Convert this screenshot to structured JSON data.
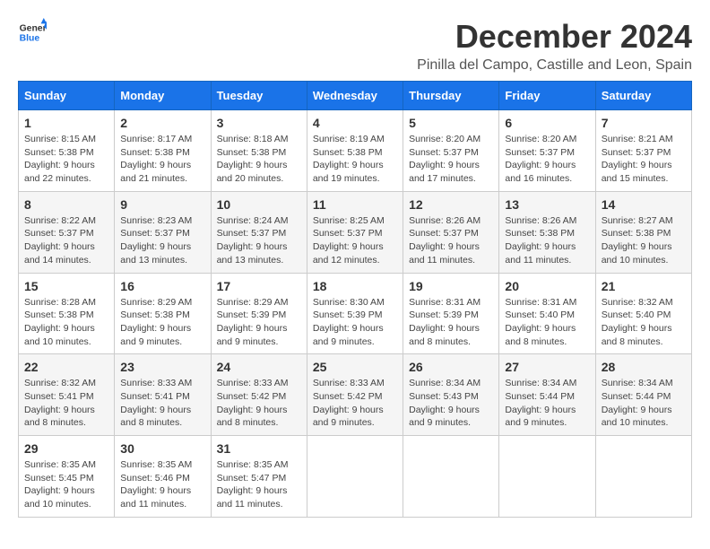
{
  "logo": {
    "line1": "General",
    "line2": "Blue"
  },
  "header": {
    "month_title": "December 2024",
    "location": "Pinilla del Campo, Castille and Leon, Spain"
  },
  "calendar": {
    "days_of_week": [
      "Sunday",
      "Monday",
      "Tuesday",
      "Wednesday",
      "Thursday",
      "Friday",
      "Saturday"
    ],
    "weeks": [
      [
        {
          "day": "1",
          "sunrise": "8:15 AM",
          "sunset": "5:38 PM",
          "daylight": "9 hours and 22 minutes."
        },
        {
          "day": "2",
          "sunrise": "8:17 AM",
          "sunset": "5:38 PM",
          "daylight": "9 hours and 21 minutes."
        },
        {
          "day": "3",
          "sunrise": "8:18 AM",
          "sunset": "5:38 PM",
          "daylight": "9 hours and 20 minutes."
        },
        {
          "day": "4",
          "sunrise": "8:19 AM",
          "sunset": "5:38 PM",
          "daylight": "9 hours and 19 minutes."
        },
        {
          "day": "5",
          "sunrise": "8:20 AM",
          "sunset": "5:37 PM",
          "daylight": "9 hours and 17 minutes."
        },
        {
          "day": "6",
          "sunrise": "8:20 AM",
          "sunset": "5:37 PM",
          "daylight": "9 hours and 16 minutes."
        },
        {
          "day": "7",
          "sunrise": "8:21 AM",
          "sunset": "5:37 PM",
          "daylight": "9 hours and 15 minutes."
        }
      ],
      [
        {
          "day": "8",
          "sunrise": "8:22 AM",
          "sunset": "5:37 PM",
          "daylight": "9 hours and 14 minutes."
        },
        {
          "day": "9",
          "sunrise": "8:23 AM",
          "sunset": "5:37 PM",
          "daylight": "9 hours and 13 minutes."
        },
        {
          "day": "10",
          "sunrise": "8:24 AM",
          "sunset": "5:37 PM",
          "daylight": "9 hours and 13 minutes."
        },
        {
          "day": "11",
          "sunrise": "8:25 AM",
          "sunset": "5:37 PM",
          "daylight": "9 hours and 12 minutes."
        },
        {
          "day": "12",
          "sunrise": "8:26 AM",
          "sunset": "5:37 PM",
          "daylight": "9 hours and 11 minutes."
        },
        {
          "day": "13",
          "sunrise": "8:26 AM",
          "sunset": "5:38 PM",
          "daylight": "9 hours and 11 minutes."
        },
        {
          "day": "14",
          "sunrise": "8:27 AM",
          "sunset": "5:38 PM",
          "daylight": "9 hours and 10 minutes."
        }
      ],
      [
        {
          "day": "15",
          "sunrise": "8:28 AM",
          "sunset": "5:38 PM",
          "daylight": "9 hours and 10 minutes."
        },
        {
          "day": "16",
          "sunrise": "8:29 AM",
          "sunset": "5:38 PM",
          "daylight": "9 hours and 9 minutes."
        },
        {
          "day": "17",
          "sunrise": "8:29 AM",
          "sunset": "5:39 PM",
          "daylight": "9 hours and 9 minutes."
        },
        {
          "day": "18",
          "sunrise": "8:30 AM",
          "sunset": "5:39 PM",
          "daylight": "9 hours and 9 minutes."
        },
        {
          "day": "19",
          "sunrise": "8:31 AM",
          "sunset": "5:39 PM",
          "daylight": "9 hours and 8 minutes."
        },
        {
          "day": "20",
          "sunrise": "8:31 AM",
          "sunset": "5:40 PM",
          "daylight": "9 hours and 8 minutes."
        },
        {
          "day": "21",
          "sunrise": "8:32 AM",
          "sunset": "5:40 PM",
          "daylight": "9 hours and 8 minutes."
        }
      ],
      [
        {
          "day": "22",
          "sunrise": "8:32 AM",
          "sunset": "5:41 PM",
          "daylight": "9 hours and 8 minutes."
        },
        {
          "day": "23",
          "sunrise": "8:33 AM",
          "sunset": "5:41 PM",
          "daylight": "9 hours and 8 minutes."
        },
        {
          "day": "24",
          "sunrise": "8:33 AM",
          "sunset": "5:42 PM",
          "daylight": "9 hours and 8 minutes."
        },
        {
          "day": "25",
          "sunrise": "8:33 AM",
          "sunset": "5:42 PM",
          "daylight": "9 hours and 9 minutes."
        },
        {
          "day": "26",
          "sunrise": "8:34 AM",
          "sunset": "5:43 PM",
          "daylight": "9 hours and 9 minutes."
        },
        {
          "day": "27",
          "sunrise": "8:34 AM",
          "sunset": "5:44 PM",
          "daylight": "9 hours and 9 minutes."
        },
        {
          "day": "28",
          "sunrise": "8:34 AM",
          "sunset": "5:44 PM",
          "daylight": "9 hours and 10 minutes."
        }
      ],
      [
        {
          "day": "29",
          "sunrise": "8:35 AM",
          "sunset": "5:45 PM",
          "daylight": "9 hours and 10 minutes."
        },
        {
          "day": "30",
          "sunrise": "8:35 AM",
          "sunset": "5:46 PM",
          "daylight": "9 hours and 11 minutes."
        },
        {
          "day": "31",
          "sunrise": "8:35 AM",
          "sunset": "5:47 PM",
          "daylight": "9 hours and 11 minutes."
        },
        null,
        null,
        null,
        null
      ]
    ]
  }
}
